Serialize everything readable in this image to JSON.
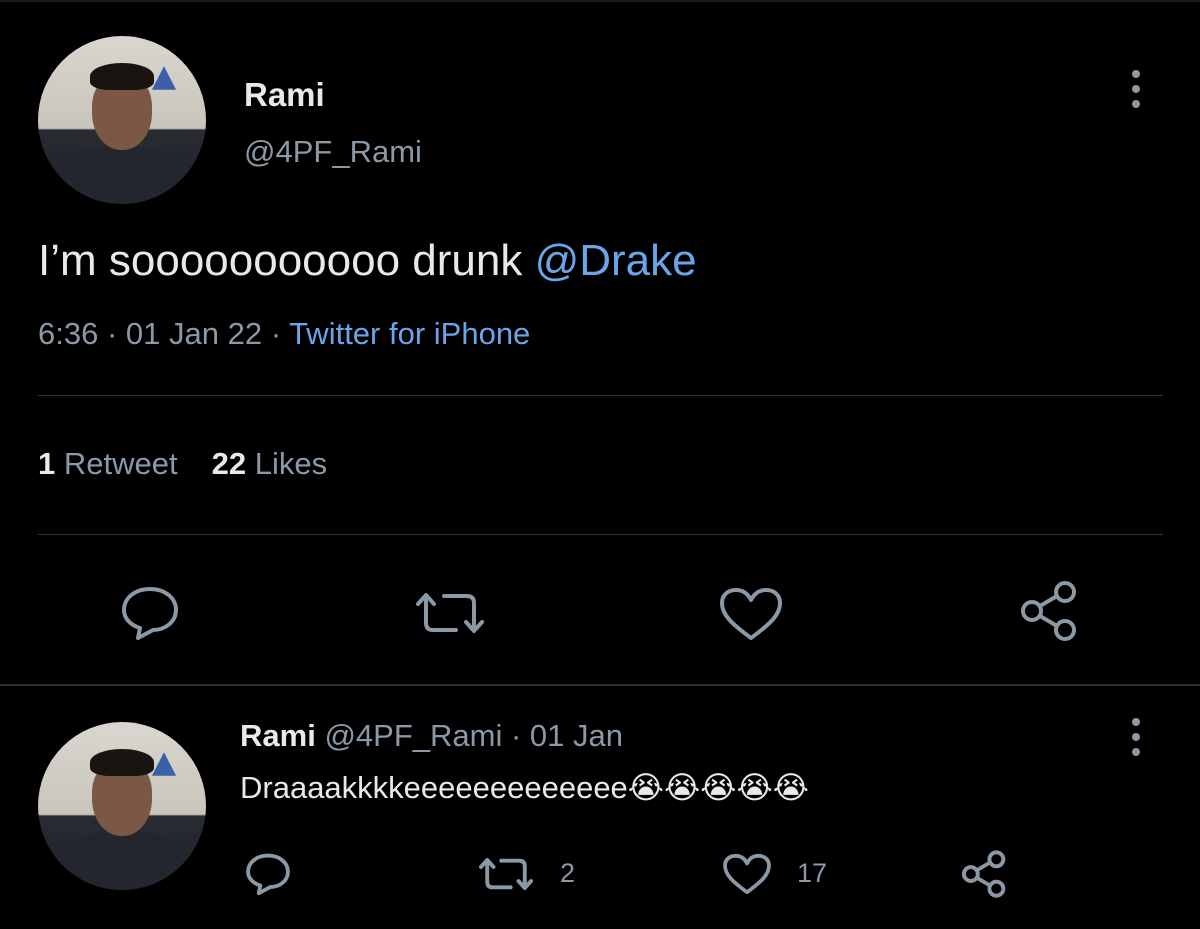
{
  "tweet": {
    "name": "Rami",
    "handle": "@4PF_Rami",
    "text_prefix": "I’m sooooooooooo drunk ",
    "mention": "@Drake",
    "time": "6:36",
    "date": "01 Jan 22",
    "separator": " · ",
    "source": "Twitter for iPhone",
    "retweet_count": "1",
    "retweet_label": "Retweet",
    "like_count": "22",
    "like_label": "Likes"
  },
  "reply": {
    "name": "Rami",
    "handle": "@4PF_Rami",
    "date": "· 01 Jan",
    "text": "Draaaakkkkeeeeeeeeeeeee😭😭😭😭😭",
    "retweet_count": "2",
    "like_count": "17"
  },
  "icons": [
    "reply-icon",
    "retweet-icon",
    "like-icon",
    "share-icon",
    "more-icon"
  ],
  "colors": {
    "background": "#000000",
    "accent": "#6ba4e8",
    "muted": "#8b98a5",
    "text": "#e7e9ea"
  }
}
